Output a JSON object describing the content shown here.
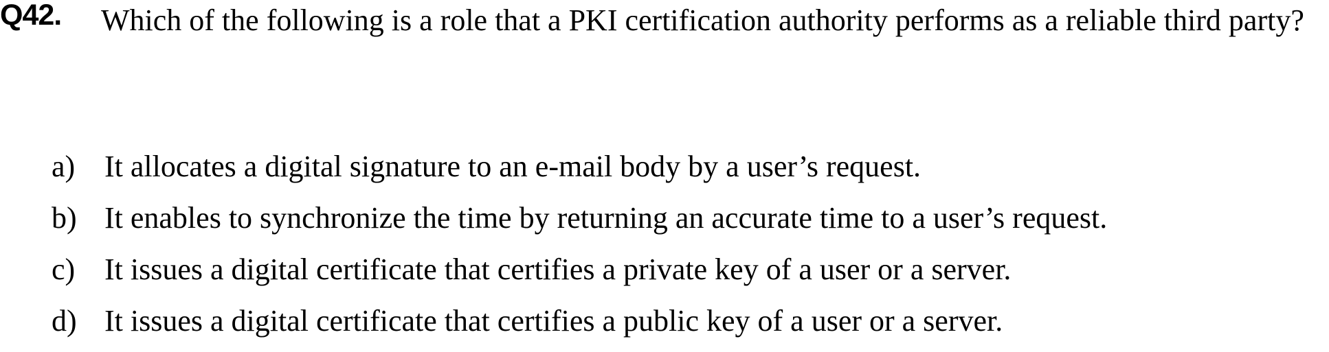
{
  "question": {
    "number": "Q42.",
    "text": "Which of the following is a role that a PKI certification authority performs as a reliable third party?"
  },
  "options": [
    {
      "label": "a)",
      "text": "It allocates a digital signature to an e-mail body by a user’s request."
    },
    {
      "label": "b)",
      "text": "It enables to synchronize the time by returning an accurate time to a user’s request."
    },
    {
      "label": "c)",
      "text": "It issues a digital certificate that certifies a private key of a user or a server."
    },
    {
      "label": "d)",
      "text": "It issues a digital certificate that certifies a public key of a user or a server."
    }
  ]
}
